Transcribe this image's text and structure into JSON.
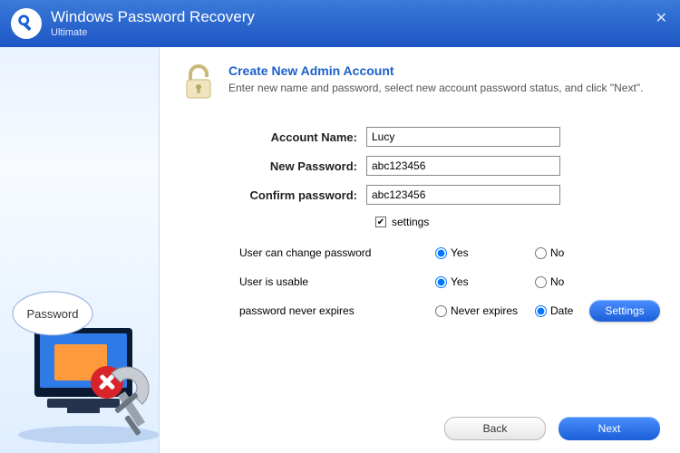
{
  "titlebar": {
    "app_name": "Windows Password Recovery",
    "edition": "Ultimate"
  },
  "header": {
    "title": "Create New Admin Account",
    "subtitle": "Enter new name and password, select new account password status, and click \"Next\"."
  },
  "form": {
    "account_label": "Account Name:",
    "account_value": "Lucy",
    "newpw_label": "New Password:",
    "newpw_value": "abc123456",
    "confirm_label": "Confirm password:",
    "confirm_value": "abc123456"
  },
  "settings_check": {
    "label": "settings",
    "checked": true
  },
  "options": {
    "row1": {
      "label": "User can change password",
      "opts": [
        "Yes",
        "No"
      ],
      "selected": 0
    },
    "row2": {
      "label": "User is usable",
      "opts": [
        "Yes",
        "No"
      ],
      "selected": 0
    },
    "row3": {
      "label": "password never expires",
      "opts": [
        "Never expires",
        "Date"
      ],
      "selected": 1
    }
  },
  "buttons": {
    "settings": "Settings",
    "back": "Back",
    "next": "Next"
  },
  "sidebar": {
    "badge": "Password"
  }
}
